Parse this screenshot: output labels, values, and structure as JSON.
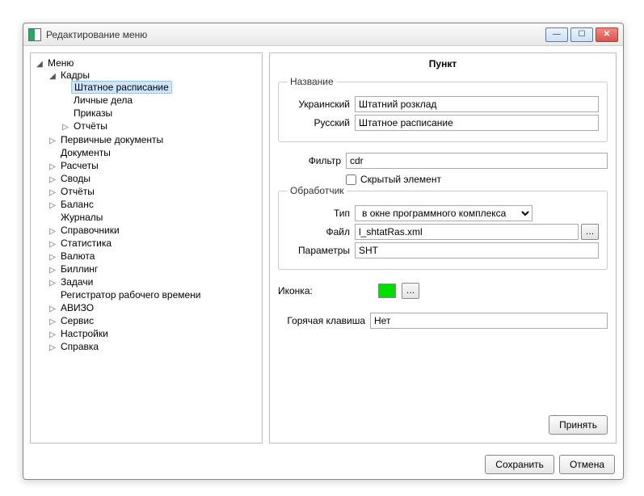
{
  "window": {
    "title": "Редактирование меню"
  },
  "tree": {
    "root": "Меню",
    "n0": "Кадры",
    "n0_0": "Штатное расписание",
    "n0_1": "Личные дела",
    "n0_2": "Приказы",
    "n0_3": "Отчёты",
    "n1": "Первичные документы",
    "n2": "Документы",
    "n3": "Расчеты",
    "n4": "Своды",
    "n5": "Отчёты",
    "n6": "Баланс",
    "n7": "Журналы",
    "n8": "Справочники",
    "n9": "Статистика",
    "n10": "Валюта",
    "n11": "Биллинг",
    "n12": "Задачи",
    "n13": "Регистратор рабочего времени",
    "n14": "АВИЗО",
    "n15": "Сервис",
    "n16": "Настройки",
    "n17": "Справка"
  },
  "pane": {
    "header": "Пункт",
    "name_legend": "Название",
    "ukr_label": "Украинский",
    "ukr_value": "Штатний розклад",
    "rus_label": "Русский",
    "rus_value": "Штатное расписание",
    "filter_label": "Фильтр",
    "filter_value": "cdr",
    "hidden_label": "Скрытый элемент",
    "handler_legend": "Обработчик",
    "type_label": "Тип",
    "type_value": "в окне программного комплекса",
    "file_label": "Файл",
    "file_value": "l_shtatRas.xml",
    "params_label": "Параметры",
    "params_value": "SHT",
    "icon_label": "Иконка:",
    "icon_color": "#00dd00",
    "hotkey_label": "Горячая клавиша",
    "hotkey_value": "Нет",
    "accept": "Принять"
  },
  "footer": {
    "save": "Сохранить",
    "cancel": "Отмена"
  }
}
